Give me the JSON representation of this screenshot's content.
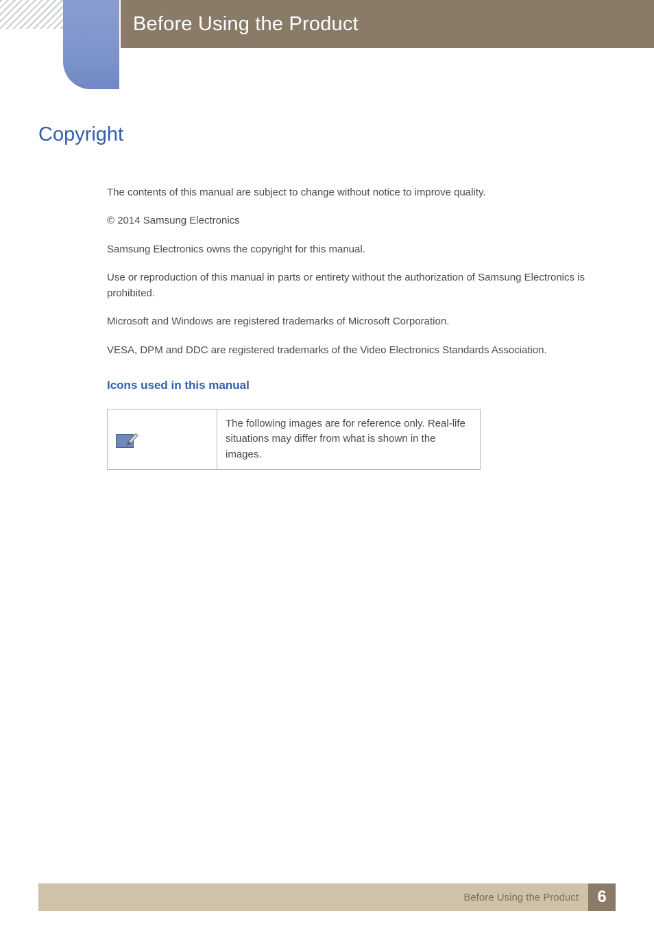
{
  "header": {
    "chapter_title": "Before Using the Product"
  },
  "section": {
    "heading": "Copyright"
  },
  "paragraphs": {
    "p1": "The contents of this manual are subject to change without notice to improve quality.",
    "p2": "© 2014 Samsung Electronics",
    "p3": "Samsung Electronics owns the copyright for this manual.",
    "p4": "Use or reproduction of this manual in parts or entirety without the authorization of Samsung Electronics is prohibited.",
    "p5": "Microsoft and Windows are registered trademarks of Microsoft Corporation.",
    "p6": "VESA, DPM and DDC are registered trademarks of the Video Electronics Standards Association."
  },
  "subsection": {
    "heading": "Icons used in this manual"
  },
  "icon_table": {
    "row1": {
      "description": "The following images are for reference only. Real-life situations may differ from what is shown in the images."
    }
  },
  "footer": {
    "label": "Before Using the Product",
    "page": "6"
  }
}
